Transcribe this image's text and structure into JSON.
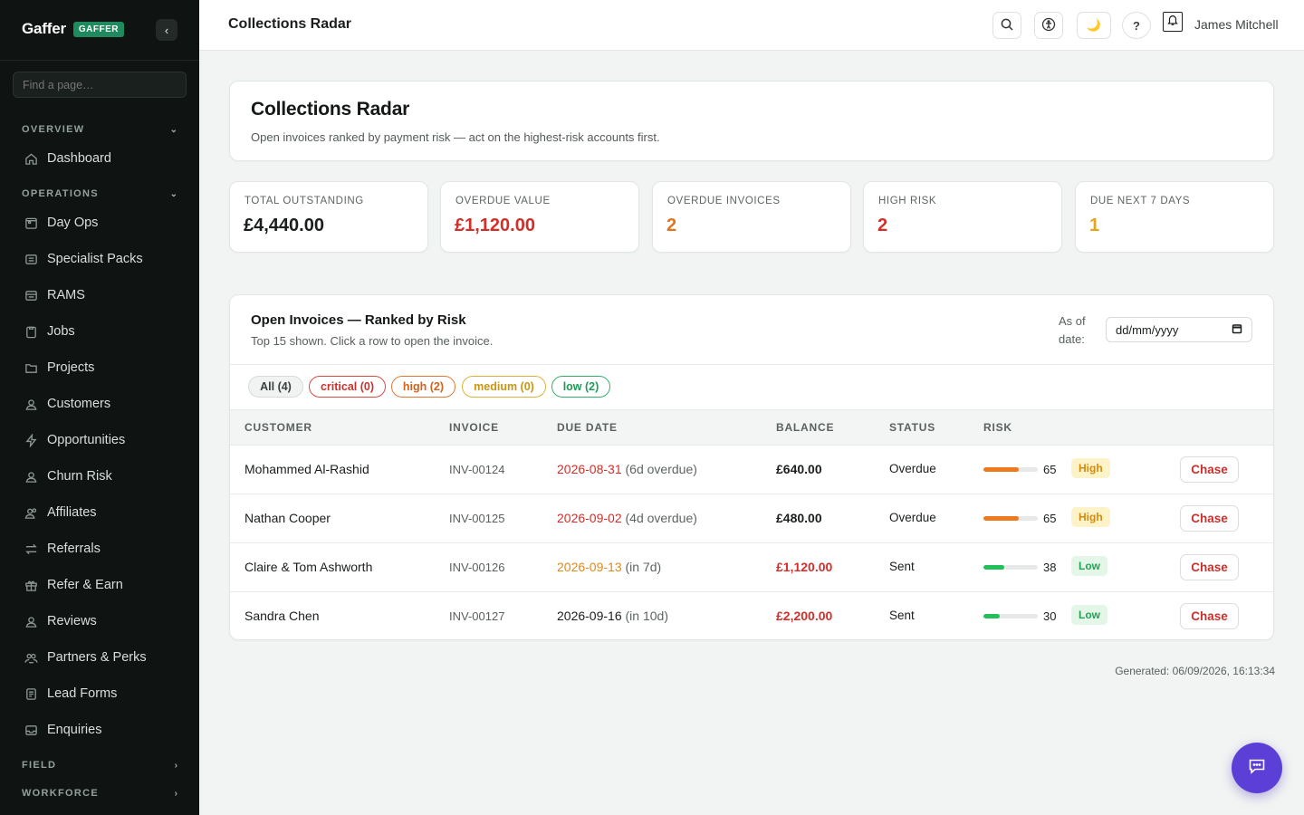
{
  "app": {
    "name": "Gaffer",
    "badge": "GAFFER"
  },
  "sidebar": {
    "search_placeholder": "Find a page…",
    "groups": [
      {
        "label": "OVERVIEW",
        "state": "expanded"
      },
      {
        "label": "OPERATIONS",
        "state": "expanded"
      },
      {
        "label": "FIELD",
        "state": "collapsed"
      },
      {
        "label": "WORKFORCE",
        "state": "collapsed"
      }
    ],
    "items": [
      {
        "label": "Dashboard",
        "icon": "home-icon"
      },
      {
        "label": "Day Ops",
        "icon": "calendar-icon"
      },
      {
        "label": "Specialist Packs",
        "icon": "pack-icon"
      },
      {
        "label": "RAMS",
        "icon": "document-icon"
      },
      {
        "label": "Jobs",
        "icon": "clipboard-icon"
      },
      {
        "label": "Projects",
        "icon": "folder-icon"
      },
      {
        "label": "Customers",
        "icon": "user-icon"
      },
      {
        "label": "Opportunities",
        "icon": "lightning-icon"
      },
      {
        "label": "Churn Risk",
        "icon": "user-icon"
      },
      {
        "label": "Affiliates",
        "icon": "users-icon"
      },
      {
        "label": "Referrals",
        "icon": "arrows-icon"
      },
      {
        "label": "Refer & Earn",
        "icon": "gift-icon"
      },
      {
        "label": "Reviews",
        "icon": "user-icon"
      },
      {
        "label": "Partners & Perks",
        "icon": "users-icon"
      },
      {
        "label": "Lead Forms",
        "icon": "form-icon"
      },
      {
        "label": "Enquiries",
        "icon": "inbox-icon"
      }
    ]
  },
  "topbar": {
    "title": "Collections Radar",
    "theme_glyph": "🌙",
    "help_label": "?",
    "user": "James Mitchell"
  },
  "hero": {
    "title": "Collections Radar",
    "subtitle": "Open invoices ranked by payment risk — act on the highest-risk accounts first."
  },
  "stats": [
    {
      "label": "TOTAL OUTSTANDING",
      "value": "£4,440.00",
      "color": "#1a1f1d"
    },
    {
      "label": "OVERDUE VALUE",
      "value": "£1,120.00",
      "color": "#d22f2a"
    },
    {
      "label": "OVERDUE INVOICES",
      "value": "2",
      "color": "#e0741f"
    },
    {
      "label": "HIGH RISK",
      "value": "2",
      "color": "#d22f2a"
    },
    {
      "label": "DUE NEXT 7 DAYS",
      "value": "1",
      "color": "#e3a51c"
    }
  ],
  "invoices": {
    "title": "Open Invoices — Ranked by Risk",
    "subtitle": "Top 15 shown. Click a row to open the invoice.",
    "as_of_line1": "As of",
    "as_of_line2": "date:",
    "date_placeholder": "dd/mm/yyyy",
    "filters": [
      {
        "label": "All (4)",
        "color": "#3a403d",
        "bg": "#f1f3f2",
        "border": "#d6dbd8"
      },
      {
        "label": "critical (0)",
        "color": "#c8322d",
        "bg": "#ffffff",
        "border": "#d94a45"
      },
      {
        "label": "high (2)",
        "color": "#d2621c",
        "bg": "#ffffff",
        "border": "#e07a34"
      },
      {
        "label": "medium (0)",
        "color": "#c99614",
        "bg": "#ffffff",
        "border": "#dcb23a"
      },
      {
        "label": "low (2)",
        "color": "#1f9a55",
        "bg": "#ffffff",
        "border": "#39ad6c"
      }
    ],
    "columns": [
      "CUSTOMER",
      "INVOICE",
      "DUE DATE",
      "BALANCE",
      "STATUS",
      "RISK"
    ],
    "rows": [
      {
        "customer": "Mohammed Al-Rashid",
        "invoice": "INV-00124",
        "due": "2026-08-31",
        "due_note": "(6d overdue)",
        "due_color": "#d22f2a",
        "balance": "£640.00",
        "balance_color": "#1a1f1d",
        "status": "Overdue",
        "risk_score": 65,
        "risk_fill": 0.65,
        "risk_color": "#ee7a1d",
        "risk_label": "High",
        "badge_bg": "#fdf3c8",
        "badge_color": "#d58a0e",
        "action": "Chase"
      },
      {
        "customer": "Nathan Cooper",
        "invoice": "INV-00125",
        "due": "2026-09-02",
        "due_note": "(4d overdue)",
        "due_color": "#d22f2a",
        "balance": "£480.00",
        "balance_color": "#1a1f1d",
        "status": "Overdue",
        "risk_score": 65,
        "risk_fill": 0.65,
        "risk_color": "#ee7a1d",
        "risk_label": "High",
        "badge_bg": "#fdf3c8",
        "badge_color": "#d58a0e",
        "action": "Chase"
      },
      {
        "customer": "Claire & Tom Ashworth",
        "invoice": "INV-00126",
        "due": "2026-09-13",
        "due_note": "(in 7d)",
        "due_color": "#dd8a1e",
        "balance": "£1,120.00",
        "balance_color": "#d22f2a",
        "status": "Sent",
        "risk_score": 38,
        "risk_fill": 0.38,
        "risk_color": "#22c05a",
        "risk_label": "Low",
        "badge_bg": "#e3f6e8",
        "badge_color": "#23a356",
        "action": "Chase"
      },
      {
        "customer": "Sandra Chen",
        "invoice": "INV-00127",
        "due": "2026-09-16",
        "due_note": "(in 10d)",
        "due_color": "#1a1f1d",
        "balance": "£2,200.00",
        "balance_color": "#d22f2a",
        "status": "Sent",
        "risk_score": 30,
        "risk_fill": 0.3,
        "risk_color": "#22c05a",
        "risk_label": "Low",
        "badge_bg": "#e3f6e8",
        "badge_color": "#23a356",
        "action": "Chase"
      }
    ]
  },
  "generated": "Generated: 06/09/2026, 16:13:34",
  "fab_icon": "chat-icon"
}
